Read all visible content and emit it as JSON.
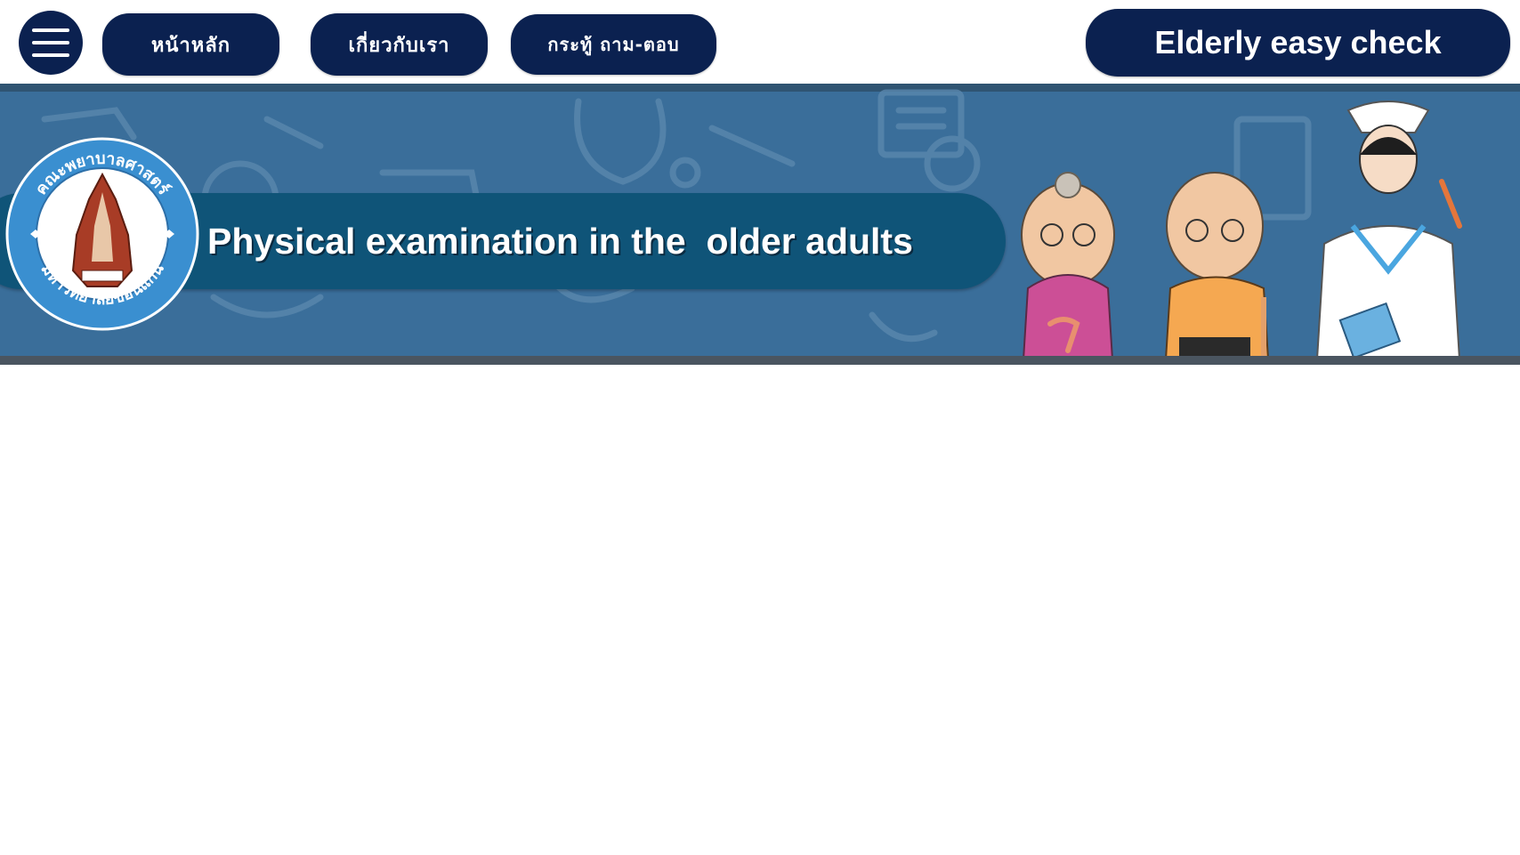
{
  "nav": {
    "menu_icon": "hamburger-menu-icon",
    "home_label": "หน้าหลัก",
    "about_label": "เกี่ยวกับเรา",
    "qa_label": "กระทู้ ถาม-ตอบ"
  },
  "brand": {
    "label": "Elderly easy check"
  },
  "banner": {
    "title": "Physical examination in the  older adults",
    "logo_top_text": "คณะพยาบาลศาสตร์",
    "logo_bottom_text": "มหาวิทยาลัยขอนแก่น"
  },
  "colors": {
    "nav_bg": "#0b2150",
    "banner_bg": "#3a6e9a",
    "title_band": "#0f5478",
    "logo_ring": "#3a8fd0"
  }
}
